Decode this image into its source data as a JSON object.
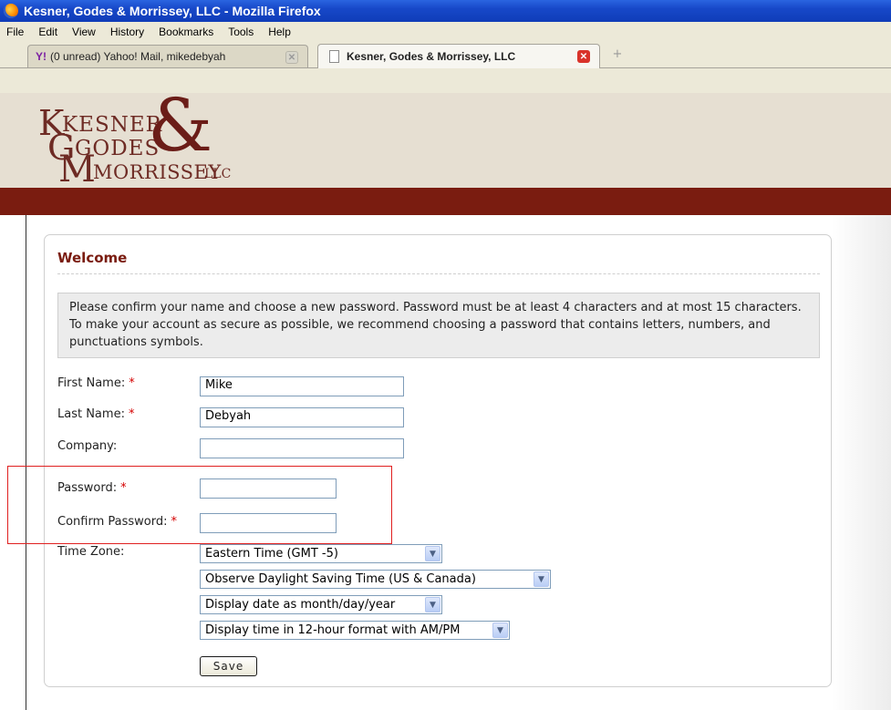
{
  "window": {
    "title": "Kesner, Godes & Morrissey, LLC - Mozilla Firefox"
  },
  "menu": [
    "File",
    "Edit",
    "View",
    "History",
    "Bookmarks",
    "Tools",
    "Help"
  ],
  "tabs": [
    {
      "label": "(0 unread) Yahoo! Mail, mikedebyah",
      "icon": "yahoo-icon",
      "active": false
    },
    {
      "label": "Kesner, Godes & Morrissey, LLC",
      "icon": "page-icon",
      "active": true
    }
  ],
  "logo": {
    "line1": "KESNER",
    "line2": "GODES",
    "line3": "MORRISSEY",
    "suffix": "LLC",
    "ampersand": "&"
  },
  "panel": {
    "title": "Welcome",
    "notice": "Please confirm your name and choose a new password. Password must be at least 4 characters and at most 15 characters. To make your account as secure as possible, we recommend choosing a password that contains letters, numbers, and punctuations symbols."
  },
  "form": {
    "first_name_label": "First Name:",
    "first_name_value": "Mike",
    "last_name_label": "Last Name:",
    "last_name_value": "Debyah",
    "company_label": "Company:",
    "company_value": "",
    "password_label": "Password:",
    "confirm_password_label": "Confirm Password:",
    "required_marker": "*",
    "time_zone_label": "Time Zone:",
    "time_zone_value": "Eastern Time (GMT -5)",
    "dst_value": "Observe Daylight Saving Time (US & Canada)",
    "date_format_value": "Display date as month/day/year",
    "time_format_value": "Display time in 12-hour format with AM/PM",
    "save_label": "Save"
  },
  "colors": {
    "accent": "#7a1c10",
    "header_bg": "#e6dfd2",
    "required": "#d40000",
    "highlight": "#e02020"
  }
}
